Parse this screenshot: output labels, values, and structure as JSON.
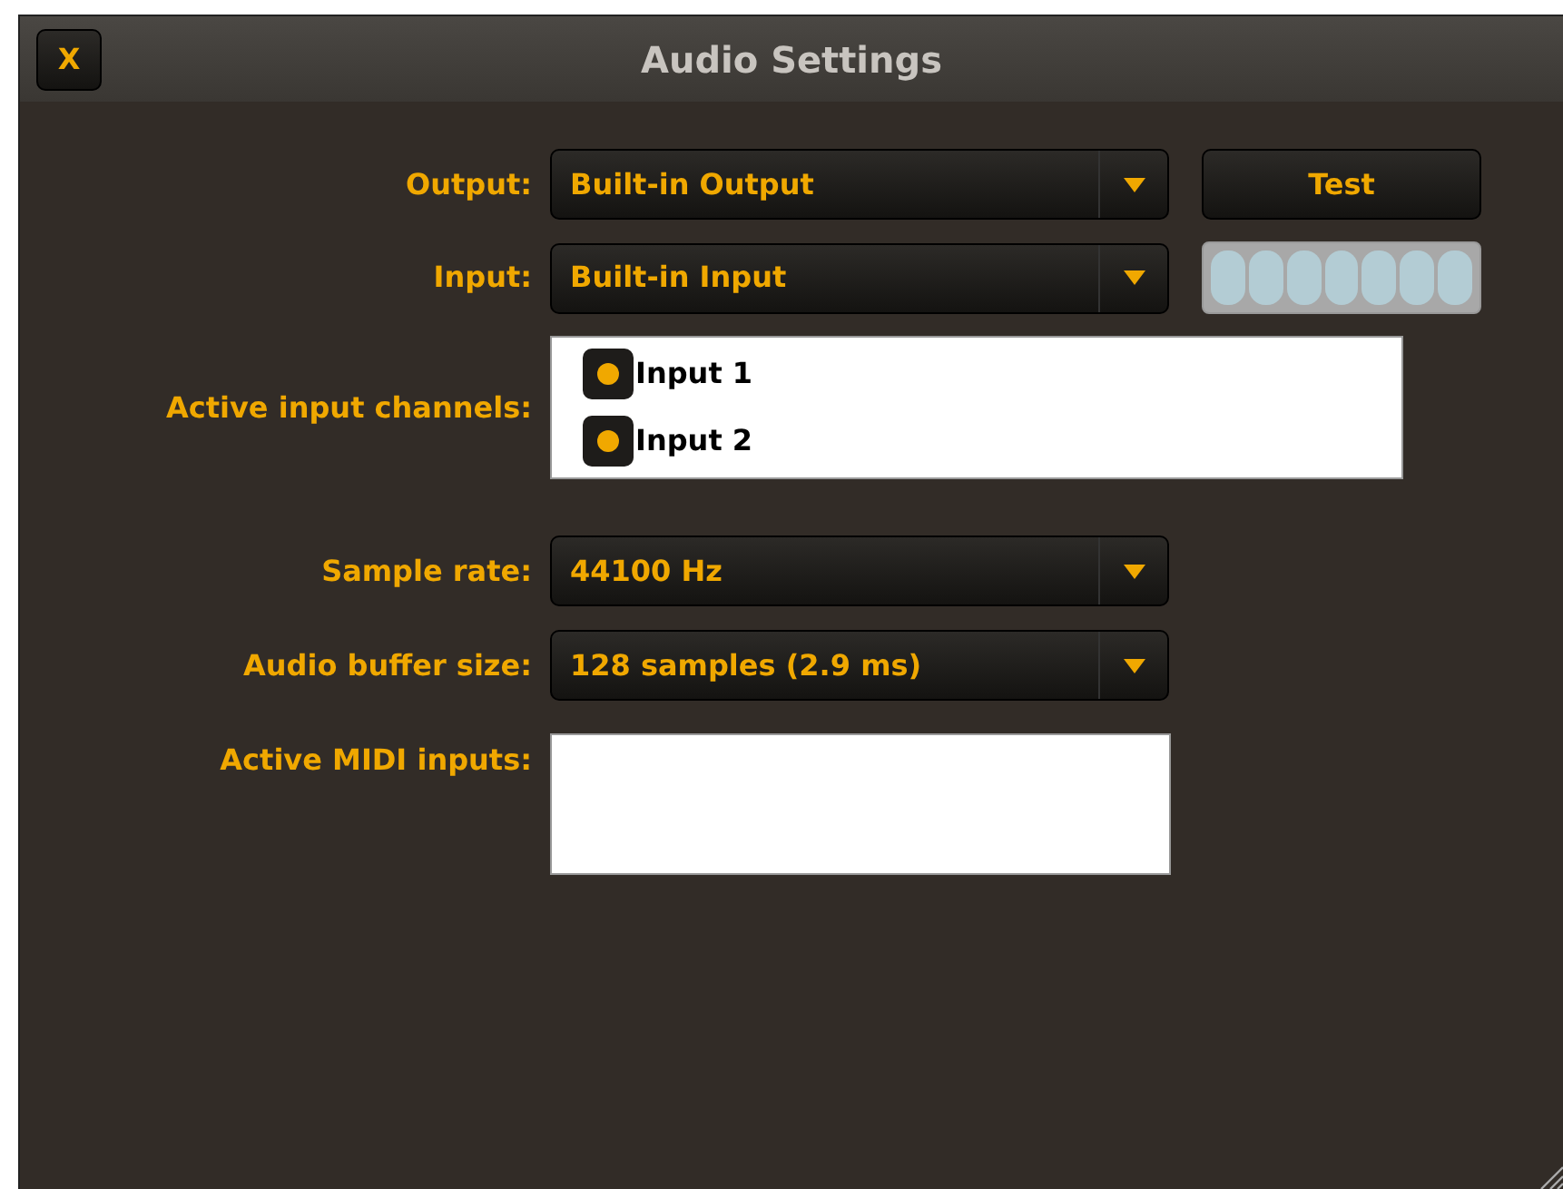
{
  "window": {
    "title": "Audio Settings",
    "close_label": "X"
  },
  "output": {
    "label": "Output:",
    "value": "Built-in Output"
  },
  "test_button": "Test",
  "input": {
    "label": "Input:",
    "value": "Built-in Input"
  },
  "input_meter": {
    "level": 0
  },
  "active_input_channels": {
    "label": "Active input channels:",
    "items": [
      {
        "label": "Input 1",
        "checked": true
      },
      {
        "label": "Input 2",
        "checked": true
      }
    ]
  },
  "sample_rate": {
    "label": "Sample rate:",
    "value": "44100 Hz"
  },
  "buffer_size": {
    "label": "Audio buffer size:",
    "value": "128 samples (2.9 ms)"
  },
  "midi_inputs": {
    "label": "Active MIDI inputs:"
  }
}
